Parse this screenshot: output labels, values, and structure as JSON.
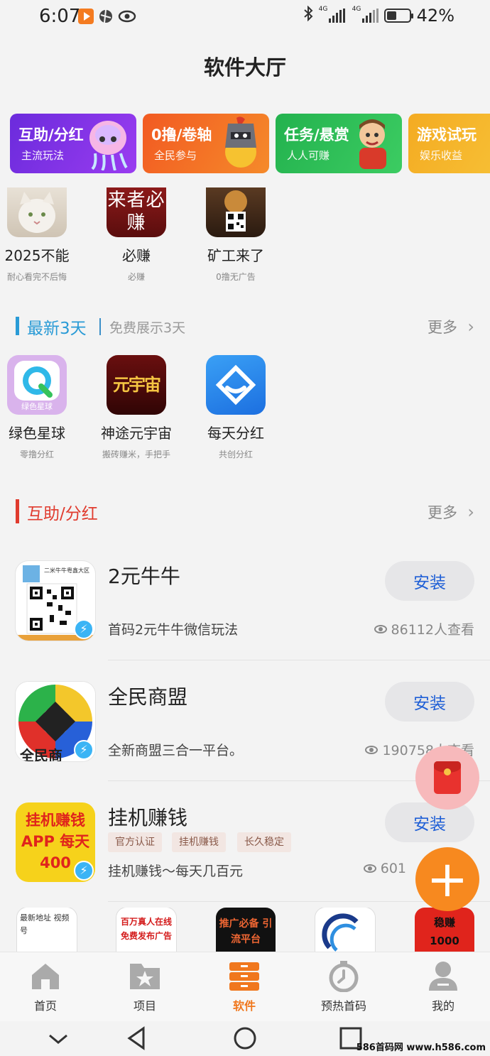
{
  "status_bar": {
    "time": "6:07",
    "battery_text": "42%",
    "battery_level": 0.42,
    "network_label_1": "4G",
    "network_label_2": "4G"
  },
  "header": {
    "title": "软件大厅"
  },
  "banners": [
    {
      "title": "互助/分红",
      "subtitle": "主流玩法",
      "color": "#7a2fe0"
    },
    {
      "title": "0撸/卷轴",
      "subtitle": "全民参与",
      "color": "#f1662a"
    },
    {
      "title": "任务/悬赏",
      "subtitle": "人人可赚",
      "color": "#2bbd57"
    },
    {
      "title": "游戏试玩",
      "subtitle": "娱乐收益",
      "color": "#f5b32a"
    }
  ],
  "recommended": [
    {
      "name": "2025不能",
      "subtitle": "耐心看完不后悔"
    },
    {
      "name": "必赚",
      "subtitle": "必赚",
      "icon_text": "来者必赚"
    },
    {
      "name": "矿工来了",
      "subtitle": "0撸无广告"
    }
  ],
  "newest": {
    "title": "最新3天",
    "subtitle": "免费展示3天",
    "more": "更多",
    "accent": "#2a9bd6",
    "items": [
      {
        "name": "绿色星球",
        "subtitle": "零撸分红",
        "icon_text": "绿色星球"
      },
      {
        "name": "神途元宇宙",
        "subtitle": "搬砖赚米，手把手",
        "icon_text": "元宇宙"
      },
      {
        "name": "每天分红",
        "subtitle": "共创分红"
      }
    ]
  },
  "mutual": {
    "title": "互助/分红",
    "more": "更多",
    "accent": "#e03b2e",
    "items": [
      {
        "name": "2元牛牛",
        "desc": "首码2元牛牛微信玩法",
        "views": "86112人查看",
        "install": "安装",
        "icon_text": "二米牛牛粤鑫大区"
      },
      {
        "name": "全民商盟",
        "desc": "全新商盟三合一平台。",
        "views": "190758人查看",
        "install": "安装",
        "icon_text": "全民商"
      },
      {
        "name": "挂机赚钱",
        "desc": "挂机赚钱～每天几百元",
        "views": "601",
        "install": "安装",
        "icon_text": "挂机赚钱 APP 每天400",
        "tags": [
          "官方认证",
          "挂机赚钱",
          "长久稳定"
        ]
      }
    ]
  },
  "bottom_strip": [
    "最新地址 视频号",
    "百万真人在线 免费发布广告",
    "推广必备 引流平台",
    "",
    "稳赚 1000"
  ],
  "tabs": [
    {
      "label": "首页",
      "icon": "home-icon"
    },
    {
      "label": "项目",
      "icon": "folder-star-icon"
    },
    {
      "label": "软件",
      "icon": "drawer-icon",
      "active": true
    },
    {
      "label": "预热首码",
      "icon": "stopwatch-icon"
    },
    {
      "label": "我的",
      "icon": "person-icon"
    }
  ],
  "watermark": "586首码网 www.h586.com",
  "colors": {
    "accent_orange": "#f0771d",
    "install_blue": "#1f5fd6"
  }
}
